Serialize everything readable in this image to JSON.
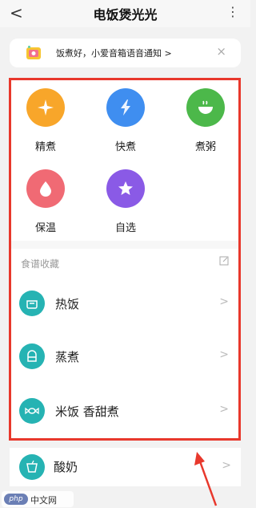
{
  "header": {
    "back_glyph": "<",
    "title": "电饭煲光光",
    "more_glyph": "⋮"
  },
  "notice": {
    "text": "饭煮好，小爱音箱语音通知 >",
    "close_glyph": "×"
  },
  "modes": [
    {
      "label": "精煮",
      "color": "#f8a62a",
      "icon": "plus-sparkle-icon"
    },
    {
      "label": "快煮",
      "color": "#3f8ef0",
      "icon": "lightning-icon"
    },
    {
      "label": "煮粥",
      "color": "#4cb84a",
      "icon": "bowl-icon"
    },
    {
      "label": "保温",
      "color": "#f06a74",
      "icon": "droplet-icon"
    },
    {
      "label": "自选",
      "color": "#8a5ae6",
      "icon": "star-icon"
    }
  ],
  "recipes": {
    "section_title": "食谱收藏",
    "items": [
      {
        "label": "热饭",
        "icon": "rice-pot-icon"
      },
      {
        "label": "蒸煮",
        "icon": "steamer-icon"
      },
      {
        "label": "米饭 香甜煮",
        "icon": "candy-icon"
      }
    ],
    "chevron": ">"
  },
  "outside": {
    "label": "酸奶",
    "icon": "yogurt-cup-icon",
    "chevron": ">"
  },
  "annotation": {
    "highlight_color": "#e8382c"
  },
  "watermark": {
    "logo": "php",
    "text": "中文网"
  }
}
